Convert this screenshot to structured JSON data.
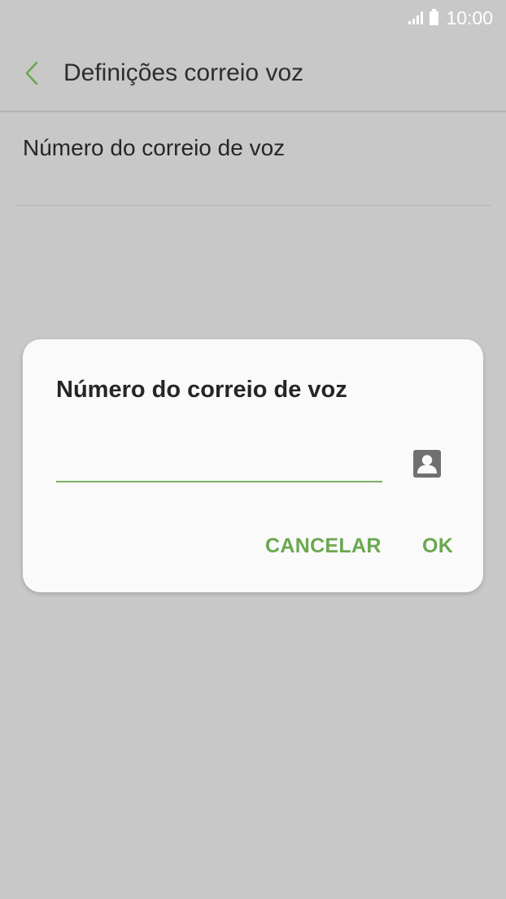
{
  "status_bar": {
    "time": "10:00",
    "icons": [
      "signal-icon",
      "battery-icon"
    ]
  },
  "app_bar": {
    "title": "Definições correio voz",
    "back_icon": "chevron-left-icon"
  },
  "settings": {
    "items": [
      {
        "label": "Número do correio de voz"
      }
    ]
  },
  "dialog": {
    "title": "Número do correio de voz",
    "input_value": "",
    "input_placeholder": "",
    "contact_icon": "contact-icon",
    "cancel_label": "CANCELAR",
    "ok_label": "OK"
  },
  "colors": {
    "accent": "#6aa84f",
    "scrim_background": "#c8c8c8",
    "dialog_background": "#fafafa",
    "text_primary": "#262626"
  }
}
